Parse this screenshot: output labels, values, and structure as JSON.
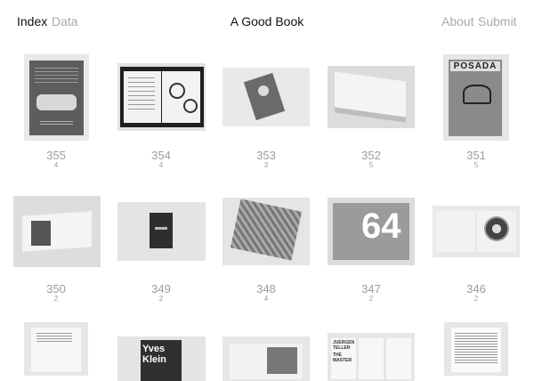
{
  "nav": {
    "index_label": "Index",
    "data_label": "Data",
    "about_label": "About",
    "submit_label": "Submit"
  },
  "site": {
    "title": "A Good Book"
  },
  "books": [
    {
      "number": "355",
      "count": "4"
    },
    {
      "number": "354",
      "count": "4"
    },
    {
      "number": "353",
      "count": "3"
    },
    {
      "number": "352",
      "count": "5"
    },
    {
      "number": "351",
      "count": "5"
    },
    {
      "number": "350",
      "count": "2"
    },
    {
      "number": "349",
      "count": "2"
    },
    {
      "number": "348",
      "count": "4"
    },
    {
      "number": "347",
      "count": "2"
    },
    {
      "number": "346",
      "count": "2"
    }
  ],
  "covers": {
    "posada_title": "POSADA",
    "big_64": "64",
    "yves_klein": "Yves Klein",
    "juergen_teller": "JUERGEN TELLER",
    "the_master": "THE MASTER"
  }
}
